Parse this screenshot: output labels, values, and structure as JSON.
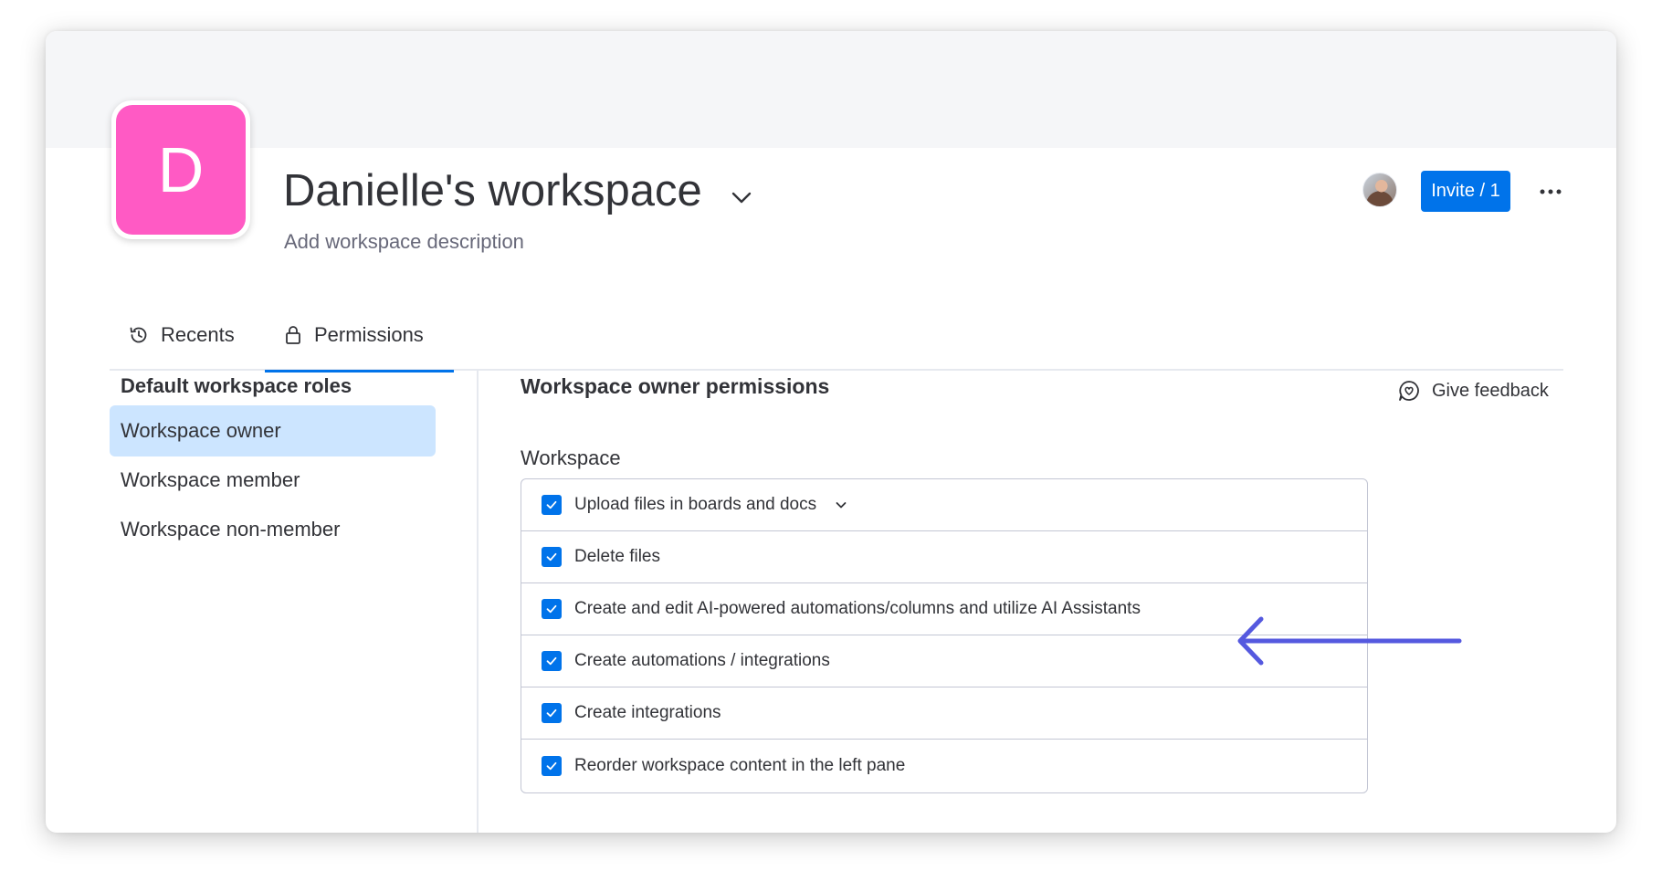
{
  "workspace": {
    "initial": "D",
    "title": "Danielle's workspace",
    "description_placeholder": "Add workspace description",
    "accent_color": "#ff5ac4"
  },
  "header": {
    "invite_label": "Invite / 1",
    "invite_color": "#0073ea",
    "more_icon": "ellipsis-icon",
    "member_avatar": "member-avatar"
  },
  "tabs": [
    {
      "label": "Recents",
      "icon": "history-icon",
      "active": false
    },
    {
      "label": "Permissions",
      "icon": "lock-icon",
      "active": true
    }
  ],
  "roles": {
    "heading": "Default workspace roles",
    "items": [
      {
        "label": "Workspace owner",
        "selected": true
      },
      {
        "label": "Workspace member",
        "selected": false
      },
      {
        "label": "Workspace non-member",
        "selected": false
      }
    ]
  },
  "permissions": {
    "heading": "Workspace owner permissions",
    "feedback_label": "Give feedback",
    "section_label": "Workspace",
    "items": [
      {
        "label": "Upload files in boards and docs",
        "checked": true,
        "has_dropdown": true
      },
      {
        "label": "Delete files",
        "checked": true
      },
      {
        "label": "Create and edit AI-powered automations/columns and utilize AI Assistants",
        "checked": true,
        "highlighted": true
      },
      {
        "label": "Create automations / integrations",
        "checked": true
      },
      {
        "label": "Create integrations",
        "checked": true
      },
      {
        "label": "Reorder workspace content in the left pane",
        "checked": true
      }
    ]
  },
  "annotation": {
    "type": "arrow-left-icon",
    "color": "#5559df"
  }
}
